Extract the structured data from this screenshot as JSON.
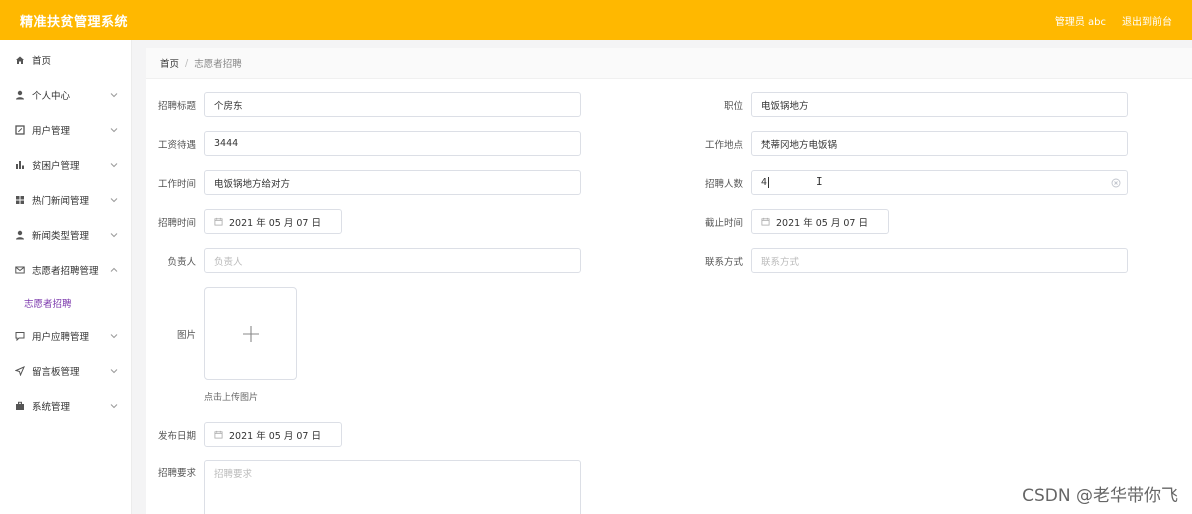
{
  "header": {
    "title": "精准扶贫管理系统",
    "admin": "管理员 abc",
    "logout": "退出到前台"
  },
  "sidebar": {
    "items": [
      {
        "label": "首页",
        "icon": "home-icon",
        "has_arrow": false
      },
      {
        "label": "个人中心",
        "icon": "user-icon",
        "has_arrow": true
      },
      {
        "label": "用户管理",
        "icon": "edit-icon",
        "has_arrow": true
      },
      {
        "label": "贫困户管理",
        "icon": "chart-icon",
        "has_arrow": true
      },
      {
        "label": "热门新闻管理",
        "icon": "grid-icon",
        "has_arrow": true
      },
      {
        "label": "新闻类型管理",
        "icon": "user-icon",
        "has_arrow": true
      },
      {
        "label": "志愿者招聘管理",
        "icon": "mail-icon",
        "has_arrow": true
      },
      {
        "label": "用户应聘管理",
        "icon": "chat-icon",
        "has_arrow": true
      },
      {
        "label": "留言板管理",
        "icon": "send-icon",
        "has_arrow": true
      },
      {
        "label": "系统管理",
        "icon": "briefcase-icon",
        "has_arrow": true
      }
    ],
    "active_sub": "志愿者招聘"
  },
  "breadcrumb": {
    "home": "首页",
    "separator": "/",
    "current": "志愿者招聘"
  },
  "form": {
    "title_label": "招聘标题",
    "title_value": "个房东",
    "position_label": "职位",
    "position_value": "电饭锅地方",
    "salary_label": "工资待遇",
    "salary_value": "3444",
    "location_label": "工作地点",
    "location_value": "梵蒂冈地方电饭锅",
    "worktime_label": "工作时间",
    "worktime_value": "电饭锅地方给对方",
    "headcount_label": "招聘人数",
    "headcount_value": "4",
    "recruit_time_label": "招聘时间",
    "recruit_time_value": "2021 年 05 月 07 日",
    "deadline_label": "截止时间",
    "deadline_value": "2021 年 05 月 07 日",
    "manager_label": "负责人",
    "manager_placeholder": "负责人",
    "contact_label": "联系方式",
    "contact_placeholder": "联系方式",
    "image_label": "图片",
    "upload_tip": "点击上传图片",
    "publish_date_label": "发布日期",
    "publish_date_value": "2021 年 05 月 07 日",
    "requirement_label": "招聘要求",
    "requirement_placeholder": "招聘要求"
  },
  "watermark": "CSDN @老华带你飞",
  "colors": {
    "header_bg": "#ffb800",
    "active_sub": "#7c3aad"
  }
}
